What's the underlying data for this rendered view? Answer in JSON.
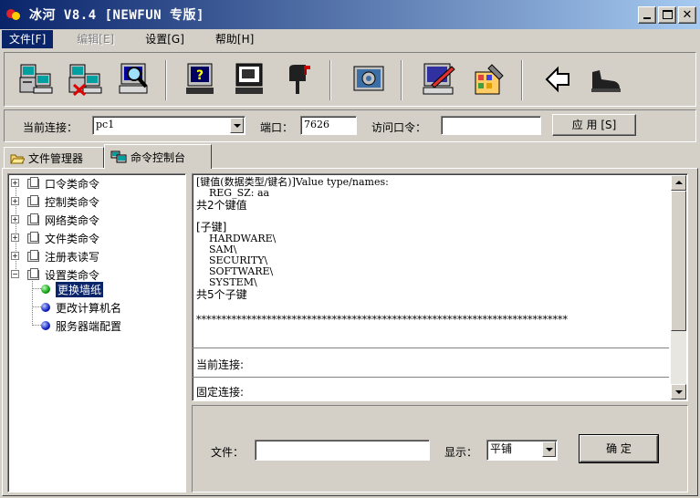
{
  "window": {
    "title": "冰河 V8.4 [NEWFUN 专版]"
  },
  "menu": {
    "file": "文件[F]",
    "edit": "编辑[E]",
    "settings": "设置[G]",
    "help": "帮助[H]"
  },
  "toolbar": {
    "buttons": [
      "add-host-icon",
      "delete-host-icon",
      "search-host-icon",
      "help-icon",
      "screen-capture-icon",
      "mailbox-icon",
      "config-icon",
      "edit-icon",
      "tools-icon",
      "back-icon",
      "exit-icon"
    ]
  },
  "connection": {
    "current_label": "当前连接：",
    "current_value": "pc1",
    "port_label": "端口：",
    "port_value": "7626",
    "password_label": "访问口令：",
    "password_value": "",
    "apply_label": "应 用 [S]"
  },
  "tabs": [
    {
      "label": "文件管理器",
      "icon": "folder-open-icon"
    },
    {
      "label": "命令控制台",
      "icon": "console-icon"
    }
  ],
  "tree": {
    "categories": [
      {
        "label": "口令类命令",
        "expander": "+"
      },
      {
        "label": "控制类命令",
        "expander": "+"
      },
      {
        "label": "网络类命令",
        "expander": "+"
      },
      {
        "label": "文件类命令",
        "expander": "+"
      },
      {
        "label": "注册表读写",
        "expander": "+"
      },
      {
        "label": "设置类命令",
        "expander": "−"
      }
    ],
    "children": [
      {
        "label": "更换墙纸",
        "color": "#10a010"
      },
      {
        "label": "更改计算机名",
        "color": "#1020c0"
      },
      {
        "label": "服务器端配置",
        "color": "#1020c0"
      }
    ]
  },
  "console": {
    "header": "[键值(数据类型/键名)]Value type/names:",
    "value_line": "REG_SZ: aa",
    "value_count": "共2个键值",
    "subkeys_header": "[子键]",
    "subkeys": [
      "HARDWARE\\",
      "SAM\\",
      "SECURITY\\",
      "SOFTWARE\\",
      "SYSTEM\\"
    ],
    "subkey_count": "共5个子键",
    "separator": "**************************************************************************",
    "current_conn_label": "当前连接:",
    "fixed_conn_label": "固定连接:"
  },
  "bottom": {
    "file_label": "文件：",
    "file_value": "",
    "display_label": "显示：",
    "display_value": "平铺",
    "confirm_label": "确 定"
  },
  "colors": {
    "titlebar_start": "#0a246a",
    "titlebar_end": "#a6caf0",
    "face": "#d4d0c8",
    "selection": "#0a246a"
  }
}
